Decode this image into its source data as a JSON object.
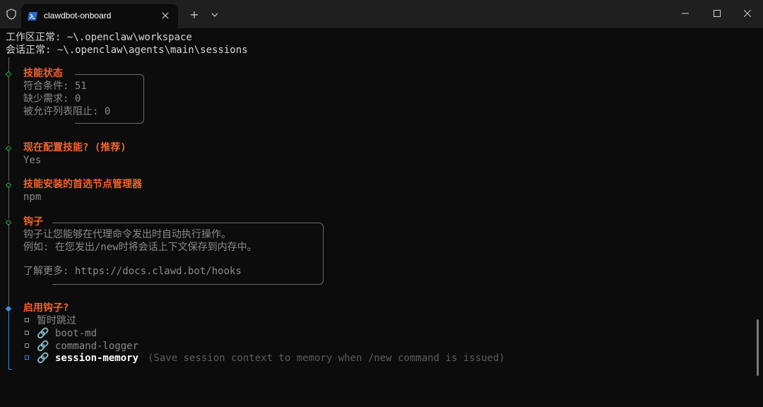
{
  "tab": {
    "title": "clawdbot-onboard"
  },
  "paths": {
    "workspace": "工作区正常: ~\\.openclaw\\workspace",
    "sessions": "会话正常: ~\\.openclaw\\agents\\main\\sessions"
  },
  "skills_status": {
    "heading": "技能状态",
    "lines": [
      "符合条件: 51",
      "缺少需求: 0",
      "被允许列表阻止: 0"
    ]
  },
  "configure_skills": {
    "question": "现在配置技能? (推荐)",
    "answer": "Yes"
  },
  "node_manager": {
    "question": "技能安装的首选节点管理器",
    "answer": "npm"
  },
  "hooks": {
    "heading": "钩子",
    "lines": [
      "钩子让您能够在代理命令发出时自动执行操作。",
      "例如: 在您发出/new时将会话上下文保存到内存中。",
      "",
      "了解更多: https://docs.clawd.bot/hooks"
    ]
  },
  "enable_hooks": {
    "question": "启用钩子?",
    "options": [
      {
        "label": "暂时跳过",
        "icon": ""
      },
      {
        "label": "boot-md",
        "icon": "🔗"
      },
      {
        "label": "command-logger",
        "icon": "🔗"
      },
      {
        "label": "session-memory",
        "icon": "🔗",
        "hint": "(Save session context to memory when /new command is issued)"
      }
    ]
  },
  "icons": {
    "shield": "shield-icon",
    "powershell": "powershell-icon",
    "link": "link-icon"
  },
  "colors": {
    "accent": "#f0642e",
    "success": "#2fb34a",
    "active": "#3b8ed8"
  }
}
